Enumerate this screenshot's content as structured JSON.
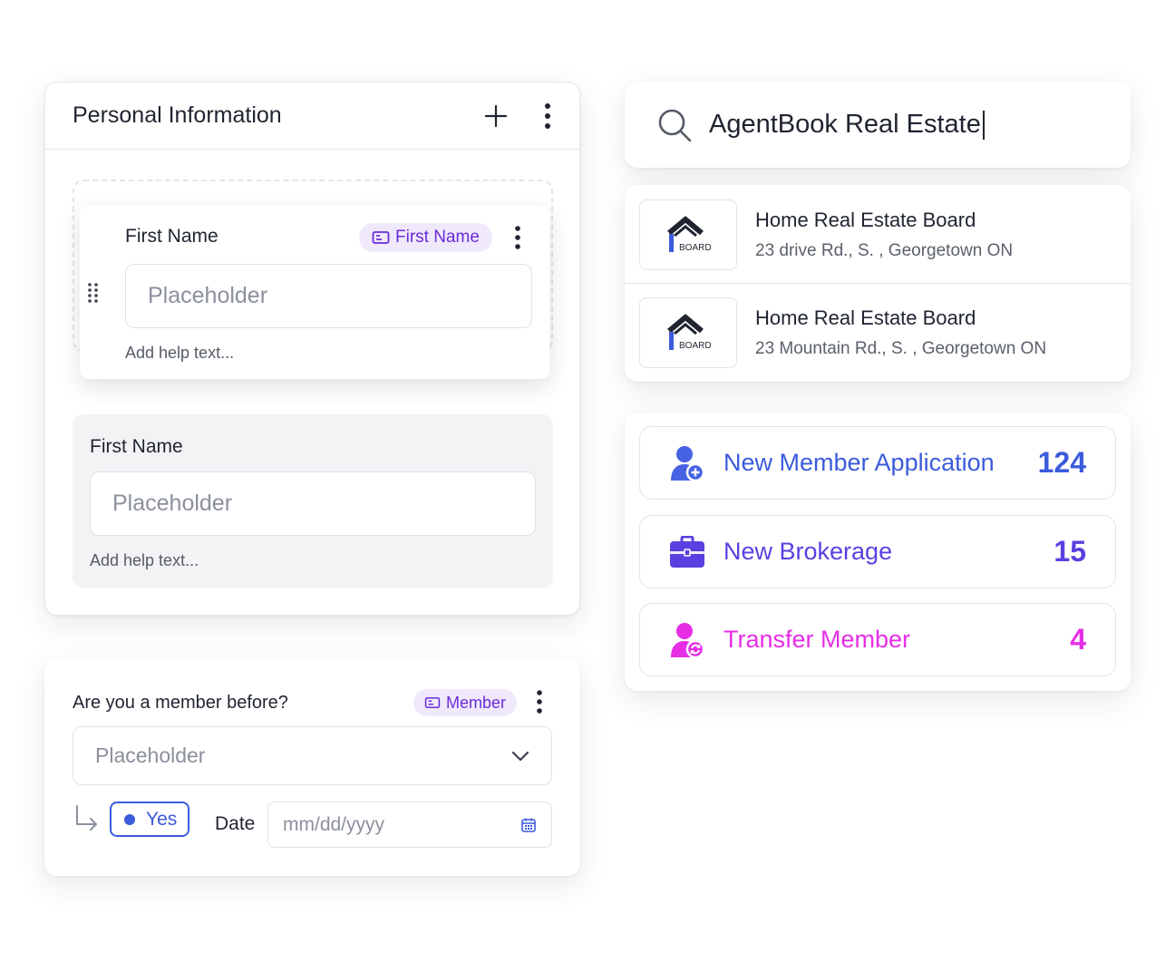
{
  "personal_info": {
    "title": "Personal Information",
    "field_active": {
      "label": "First Name",
      "tag_label": "First Name",
      "placeholder": "Placeholder",
      "help_text": "Add help text..."
    },
    "field_static": {
      "label": "First Name",
      "placeholder": "Placeholder",
      "help_text": "Add help text..."
    }
  },
  "member_question": {
    "label": "Are you a member before?",
    "tag_label": "Member",
    "select_placeholder": "Placeholder",
    "condition_value": "Yes",
    "date_label": "Date",
    "date_placeholder": "mm/dd/yyyy"
  },
  "search": {
    "value": "AgentBook Real Estate"
  },
  "results": [
    {
      "name": "Home Real Estate Board",
      "address": "23 drive Rd., S. , Georgetown ON",
      "logo_text": "BOARD"
    },
    {
      "name": "Home Real Estate Board",
      "address": "23 Mountain Rd., S. , Georgetown ON",
      "logo_text": "BOARD"
    }
  ],
  "stats": [
    {
      "label": "New Member Application",
      "count": "124",
      "icon": "user-add-icon",
      "color": "#3b5bdb"
    },
    {
      "label": "New Brokerage",
      "count": "15",
      "icon": "briefcase-icon",
      "color": "#5b3fe0"
    },
    {
      "label": "Transfer Member",
      "count": "4",
      "icon": "user-transfer-icon",
      "color": "#e62ee6"
    }
  ],
  "colors": {
    "tag_bg": "#efe9fb",
    "tag_text": "#6b2bd9",
    "accent_blue": "#3b5bdb",
    "accent_purple": "#5b3fe0",
    "accent_magenta": "#e62ee6"
  }
}
